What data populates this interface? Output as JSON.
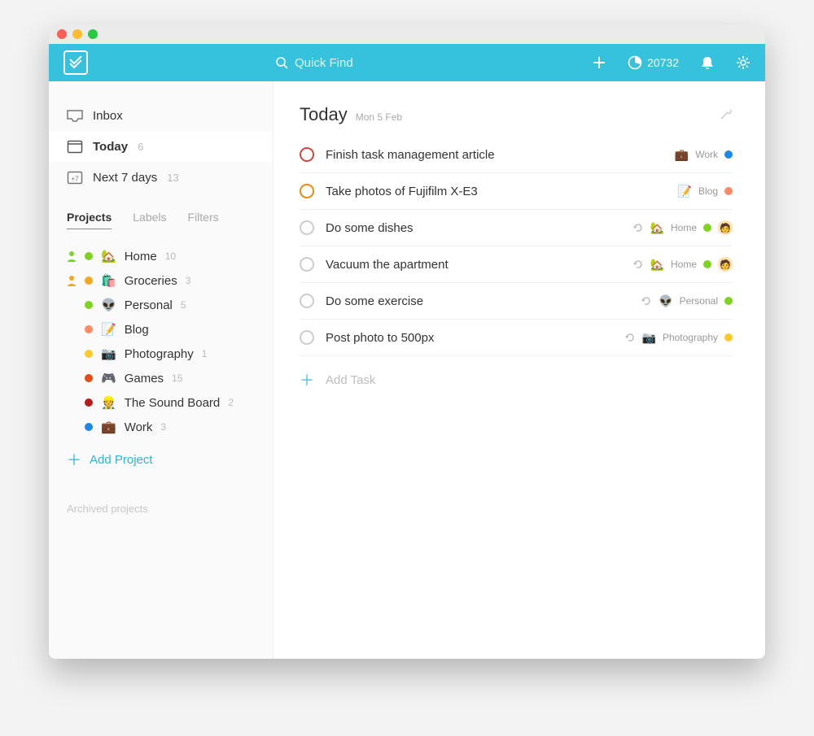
{
  "topbar": {
    "search_placeholder": "Quick Find",
    "karma_points": "20732"
  },
  "sidebar": {
    "nav": [
      {
        "key": "inbox",
        "label": "Inbox",
        "count": "",
        "active": false
      },
      {
        "key": "today",
        "label": "Today",
        "count": "6",
        "active": true
      },
      {
        "key": "next7",
        "label": "Next 7 days",
        "count": "13",
        "active": false
      }
    ],
    "tabs": [
      {
        "label": "Projects",
        "active": true
      },
      {
        "label": "Labels",
        "active": false
      },
      {
        "label": "Filters",
        "active": false
      }
    ],
    "projects": [
      {
        "color": "#7ed321",
        "shared": true,
        "emoji": "🏡",
        "name": "Home",
        "count": "10"
      },
      {
        "color": "#f5a623",
        "shared": true,
        "emoji": "🛍️",
        "name": "Groceries",
        "count": "3"
      },
      {
        "color": "#7ed321",
        "shared": false,
        "emoji": "👽",
        "name": "Personal",
        "count": "5"
      },
      {
        "color": "#ff8a65",
        "shared": false,
        "emoji": "📝",
        "name": "Blog",
        "count": ""
      },
      {
        "color": "#ffca28",
        "shared": false,
        "emoji": "📷",
        "name": "Photography",
        "count": "1"
      },
      {
        "color": "#e64a19",
        "shared": false,
        "emoji": "🎮",
        "name": "Games",
        "count": "15"
      },
      {
        "color": "#b71c1c",
        "shared": false,
        "emoji": "👷",
        "name": "The Sound Board",
        "count": "2"
      },
      {
        "color": "#1e88e5",
        "shared": false,
        "emoji": "💼",
        "name": "Work",
        "count": "3"
      }
    ],
    "add_project_label": "Add Project",
    "archived_label": "Archived projects"
  },
  "main": {
    "title": "Today",
    "date": "Mon 5 Feb",
    "add_task_label": "Add Task",
    "tasks": [
      {
        "priority": "p1",
        "title": "Finish task management article",
        "recurring": false,
        "project_emoji": "💼",
        "project_name": "Work",
        "project_color": "#1e88e5",
        "assignee": false
      },
      {
        "priority": "p2",
        "title": "Take photos of Fujifilm X-E3",
        "recurring": false,
        "project_emoji": "📝",
        "project_name": "Blog",
        "project_color": "#ff8a65",
        "assignee": false
      },
      {
        "priority": "",
        "title": "Do some dishes",
        "recurring": true,
        "project_emoji": "🏡",
        "project_name": "Home",
        "project_color": "#7ed321",
        "assignee": true
      },
      {
        "priority": "",
        "title": "Vacuum the apartment",
        "recurring": true,
        "project_emoji": "🏡",
        "project_name": "Home",
        "project_color": "#7ed321",
        "assignee": true
      },
      {
        "priority": "",
        "title": "Do some exercise",
        "recurring": true,
        "project_emoji": "👽",
        "project_name": "Personal",
        "project_color": "#7ed321",
        "assignee": false
      },
      {
        "priority": "",
        "title": "Post photo to 500px",
        "recurring": true,
        "project_emoji": "📷",
        "project_name": "Photography",
        "project_color": "#ffca28",
        "assignee": false
      }
    ]
  }
}
